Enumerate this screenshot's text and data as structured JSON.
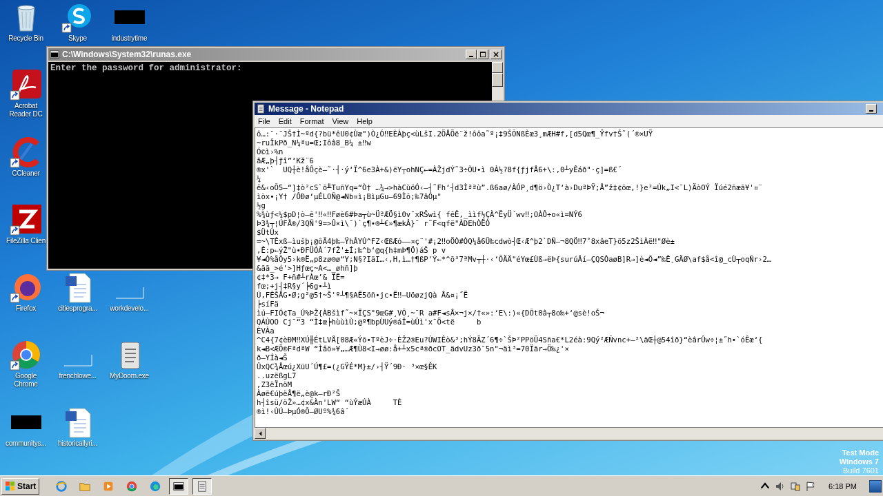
{
  "desktop": {
    "icons": [
      {
        "label": "Recycle Bin",
        "kind": "recycle",
        "shortcut": false
      },
      {
        "label": "Skype",
        "kind": "skype",
        "shortcut": true
      },
      {
        "label": "industrytime",
        "kind": "black",
        "shortcut": false
      },
      {
        "label": "Acrobat Reader DC",
        "kind": "acrobat",
        "shortcut": true
      },
      {
        "label": "CCleaner",
        "kind": "ccleaner",
        "shortcut": true
      },
      {
        "label": "FileZilla Clien",
        "kind": "filezilla",
        "shortcut": true
      },
      {
        "label": "Firefox",
        "kind": "firefox",
        "shortcut": true
      },
      {
        "label": "citiesprogra...",
        "kind": "word",
        "shortcut": false
      },
      {
        "label": "workdevelo...",
        "kind": "blank",
        "shortcut": false
      },
      {
        "label": "Google Chrome",
        "kind": "chrome",
        "shortcut": true
      },
      {
        "label": "frenchlowe...",
        "kind": "blank",
        "shortcut": false
      },
      {
        "label": "MyDoom.exe",
        "kind": "notepad",
        "shortcut": false
      },
      {
        "label": "communitys...",
        "kind": "black",
        "shortcut": false
      },
      {
        "label": "historicallyri...",
        "kind": "word",
        "shortcut": false
      }
    ],
    "notice": [
      "Test Mode",
      "Windows 7",
      "Build 7601"
    ]
  },
  "console_window": {
    "title": "C:\\Windows\\System32\\runas.exe",
    "lines": [
      "Enter the password for administrator:"
    ]
  },
  "notepad": {
    "title": "Message - Notepad",
    "menu": [
      "File",
      "Edit",
      "Format",
      "View",
      "Help"
    ],
    "lines": [
      "ô…:¨·¯JŠ†Ì~ºd{?bü*êU0¢Ùæ\")Ò¿Ó‼EÈÀþç<ùLšI.2ÖÅÖë¨ž!ôôa˜º¡‡9ŠÕNßÈæ3¸mÆH#f,[d5Qœ¶_Ÿfv†Š˜(´®×UŸ",
      "~ruÎkPð_N¼ªu=Œ;Iôâ8_B¼ ±‼w",
      "Ó©ì›%n",
      "âÆ„þ┤ƒî”‘Kž¨6",
      "®x'`  UQ┼è!åÔçè–˜·┤·ý‘Ï^6e3À+&)ëY┬ohNÇ←=ÀŽjdÝ˜3÷ÒU•ì 0À½?8f{ƒjfÅ6+\\:,0┴yÊáð\"·ç]=ß€´",
      "¼",
      "ê&‹oÕ5–“]‡ò²cS`õ╨TuñYq=“Ò† …¾→>hàCùöÓ‹–┤˜Fh‘┤d3Ìªªù”.ß6aø/ÀÓP¸d¶ö›Ò¿T‘à›DuªÞŸ;Å”ž‡¢õœ,!}e²=Úk„I<¯L)ÄòOÝ Ïúé2ñæã¥'¤¨",
      "ìòx•¡Y† /ÔÐø‘µÉLOÑ@◄Nb¤ì¡BìµGu–69Ìô;‰7âÓµ\"",
      "½g",
      "%¾ùƒ<¼$pD¦ò–ê'‼«‼Føè6#Þa┬ù~ÜªÆÖ§ì0v¯xRŠwì{ fêÊ,_ììf½ÇÀ^ËyÜ´wv‼;OÀÔ÷o«ì=NÝ6",
      "Þ3¾┬¦ÚFÅ®/3QÑ'9=>Û×ì\\¯)`ç¶•®┴€»¶ækÂ}¯ r˜F<qfë\"ÀDEhÒËÒ",
      "$ÜtÙx",
      "=~\\TÊxß–ìušþ¡@ôÄ4þ‰–ŸhÂYÚ^FZ‹ŒßÆó––¤ç¨'#¡2‼oÖÒ#ÒQ¼å6Ü‰cdwò┤Œ‹Æ^þ2`DÑ—¬8QÖ‼7˚8xâeT}ö5z2ŠìÀë‼\"Øè±",
      ",Ê:p←ýŽ\"ù•ÐFÜÓÀ´7fŽ'±Í;‰^b‘@q{h‡mÞ¶Ö)áŠ p v",
      "¥◄Ò%åÕy5›k®Ë„p8zø®ø“Y;N§?IäI…‹,H,ì…†¶ßP'Ý←*^õ³7ªMv┬┼·‹‘ÕÄÄ\"éYœ£Ùß→ëÞ{surúÂí–ÇQSÔaøB]R→]è◄Õ◄”‰Ê¸GÄØ\\af$å<î@_cÙ┬oqÑr›2…",
      "&ãã_>é'>]Hƒœç~A<…_øhñ]þ",
      "¢‡*3→ F+ñ#┴rÀœ’& ÏË=",
      "fœ;+j┤‡R§y´┝6g•┴ì",
      "Ú,FÈŠÅG•Ø;g²@5†~Š'º┴¶§AË5öñ•jc•Ë‼–UöøzjQà Å&¤¡˝Ë",
      "┝síFä",
      "ìú–FIÓ¢Ta_Ú%ÞŽ{ÀBšìf˝~×ÏÇS\"9œG#¸VÕ¸~¯R a#F◄sÅ×¬j×/†«»:‘E\\:)«{DÕt0â┬8o‰+‘@sè!oŠ¬",
      "QÀÙOO Cj¯“3 “Ì‡œ┝hùùìÙ;@º¶bpÙUý®áÎ=ùÛì'x¯Ö<të     b",
      "ÈVÀa",
      "^C4{7¢èÐM‼XÚ╫ÉtLVÅ[08Æ«Ýõ•TºèJ÷·ÈŽ2®Eu?ÚWIÊò&³;hÝ8ÄZ´6¶÷`ŠÞ²PPöÜ4Sña€*L2éà:9Qý²ÆÑvnc+–²\\ãŒ┼@54îð}“èârÛw÷¦±˝h•`óÊæ‘{",
      "k◄B<ÆÖ®FªdªW “Ìâö»¥„…Æ¶Ù8<I→øø:å+┴x5cª®ðcOT_ädvUz3ð¯5n\"¬äì³=70Ïãr→Ö‰¿'×",
      "ð–YÍà◄Š",
      "ÛxQC¾Åœú¿XüU´Ú¶£=(¿GŸÉ*M}±/›┤Ÿ´9Ð· ³×œ§ÊK",
      "..uzëßgL7",
      ",Z3ëÏnöM",
      "Àøë€úþëÅ¶ë„è@k–rÐ²Š",
      "h┤îsü/öŽ»…¢x&Àn'LW“ “ùÝæÚÀ     TÈ",
      "®ì!‹ÙÚ–ÞµÓ®Õ–ØUº%¾6â´"
    ]
  },
  "taskbar": {
    "start": "Start",
    "apps": [
      {
        "kind": "ie",
        "selected": false
      },
      {
        "kind": "folder",
        "selected": false
      },
      {
        "kind": "media",
        "selected": false
      },
      {
        "kind": "chrome",
        "selected": false
      },
      {
        "kind": "edge",
        "selected": false
      },
      {
        "kind": "console",
        "selected": true
      },
      {
        "kind": "notepad",
        "selected": true
      }
    ],
    "time": "6:18 PM"
  }
}
